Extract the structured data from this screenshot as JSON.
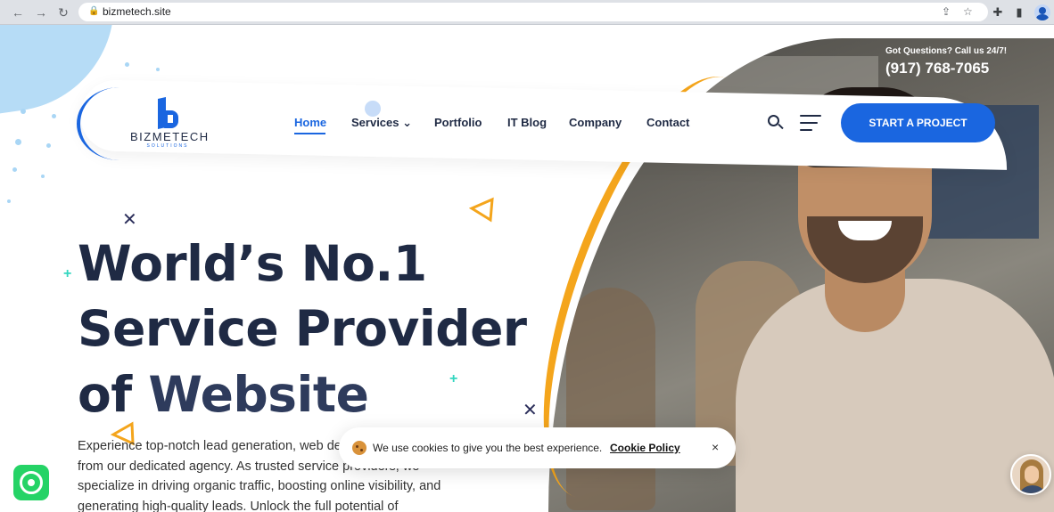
{
  "browser": {
    "url": "bizmetech.site"
  },
  "header": {
    "call_label": "Got Questions? Call us 24/7!",
    "call_number": "(917) 768-7065",
    "logo_name": "BIZMETECH",
    "logo_sub": "SOLUTIONS",
    "nav": [
      {
        "label": "Home",
        "active": true
      },
      {
        "label": "Services ⌄"
      },
      {
        "label": "Portfolio"
      },
      {
        "label": "IT Blog"
      },
      {
        "label": "Company"
      },
      {
        "label": "Contact"
      }
    ],
    "cta_label": "START A PROJECT"
  },
  "hero": {
    "line1": "World’s No.1",
    "line2": "Service Provider",
    "line3_a": "of ",
    "line3_b": "Website",
    "paragraph": "Experience top-notch lead generation, web development services from our dedicated agency. As trusted service providers, we specialize in driving organic traffic, boosting online visibility, and generating high-quality leads. Unlock the full potential of"
  },
  "cookie": {
    "message": "We use cookies to give you the best experience.",
    "policy_label": "Cookie Policy",
    "close_label": "×"
  },
  "colors": {
    "brand_blue": "#1a66e0",
    "heading_navy": "#1f2a44",
    "accent_orange": "#f4a51c",
    "accent_teal": "#33d6c0"
  }
}
